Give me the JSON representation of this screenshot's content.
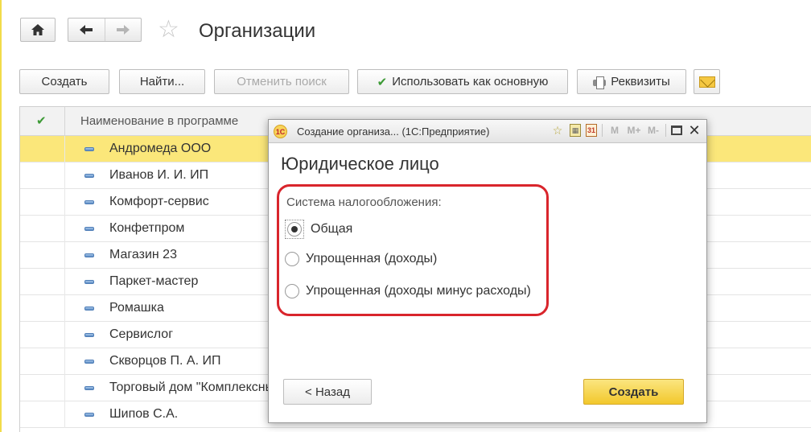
{
  "nav": {
    "home_icon": "home-icon",
    "back_icon": "arrow-left-icon",
    "forward_icon": "arrow-right-icon",
    "favorite_icon": "star-icon",
    "title": "Организации"
  },
  "toolbar": {
    "create_label": "Создать",
    "find_label": "Найти...",
    "cancel_search_label": "Отменить поиск",
    "use_as_main_label": "Использовать как основную",
    "requisites_label": "Реквизиты",
    "mail_icon": "envelope-icon"
  },
  "list": {
    "column_header": "Наименование в программе",
    "selected_index": 0,
    "rows": [
      "Андромеда ООО",
      "Иванов И. И. ИП",
      "Комфорт-сервис",
      "Конфетпром",
      "Магазин 23",
      "Паркет-мастер",
      "Ромашка",
      "Сервислог",
      "Скворцов П. А. ИП",
      "Торговый дом \"Комплексны",
      "Шипов С.А."
    ]
  },
  "dialog": {
    "window_title": "Создание организа... (1С:Предприятие)",
    "logo_text": "1С",
    "tools": {
      "m": "M",
      "mplus": "M+",
      "mminus": "M-"
    },
    "heading": "Юридическое лицо",
    "tax_label": "Система налогообложения:",
    "tax_options": [
      {
        "label": "Общая",
        "checked": true
      },
      {
        "label": "Упрощенная (доходы)",
        "checked": false
      },
      {
        "label": "Упрощенная (доходы минус расходы)",
        "checked": false
      }
    ],
    "back_button": "< Назад",
    "create_button": "Создать"
  },
  "colors": {
    "accent_yellow": "#fbe77a",
    "create_button": "#f2c82c",
    "highlight_red": "#d9252c",
    "check_green": "#3c9a35"
  }
}
